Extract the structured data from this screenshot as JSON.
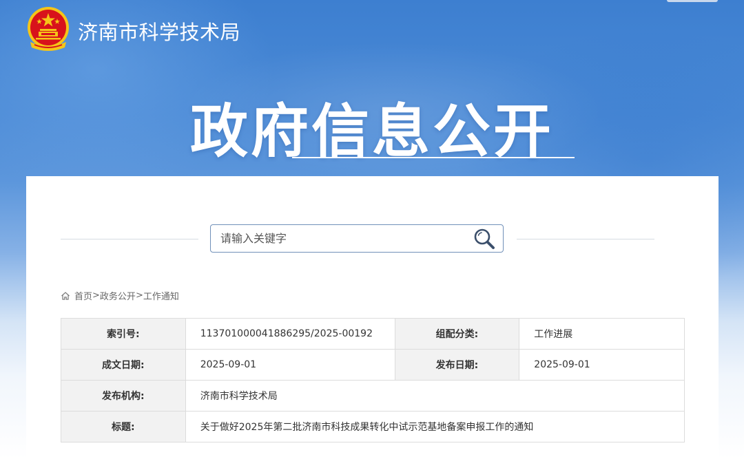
{
  "header": {
    "org_name": "济南市科学技术局",
    "page_title": "政府信息公开",
    "colors": {
      "banner": "#4b8ad6",
      "emblem_red": "#d8121b",
      "emblem_gold": "#f5c518"
    }
  },
  "search": {
    "placeholder": "请输入关键字",
    "value": "",
    "icon": "search-icon"
  },
  "breadcrumb": {
    "icon": "home-icon",
    "items": [
      {
        "label": "首页"
      },
      {
        "label": "政务公开"
      },
      {
        "label": "工作通知"
      }
    ],
    "separator": ">"
  },
  "meta_table": {
    "index_no_label": "索引号:",
    "index_no_value": "113701000041886295/2025-00192",
    "category_label": "组配分类:",
    "category_value": "工作进展",
    "written_date_label": "成文日期:",
    "written_date_value": "2025-09-01",
    "publish_date_label": "发布日期:",
    "publish_date_value": "2025-09-01",
    "publisher_label": "发布机构:",
    "publisher_value": "济南市科学技术局",
    "title_label": "标题:",
    "title_value": "关于做好2025年第二批济南市科技成果转化中试示范基地备案申报工作的通知"
  }
}
